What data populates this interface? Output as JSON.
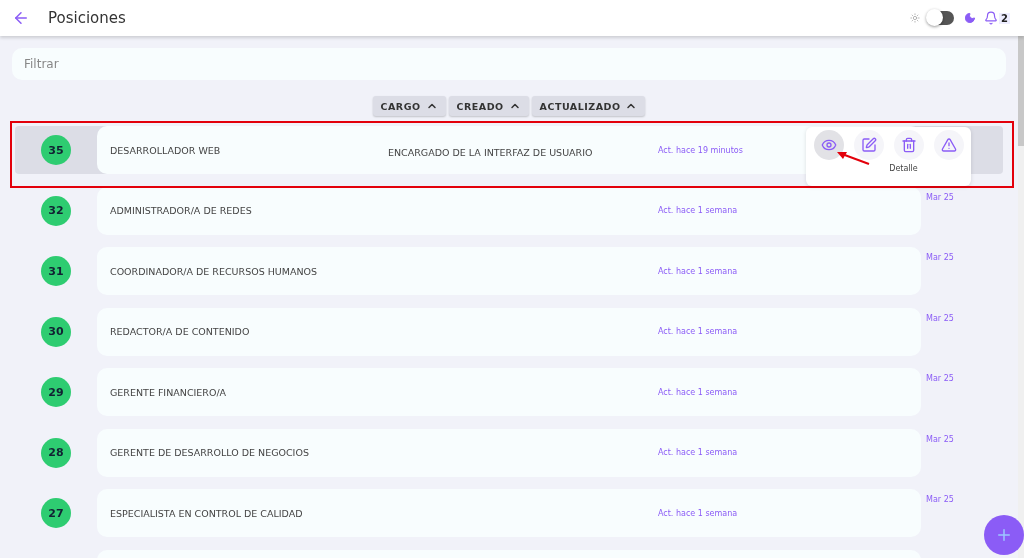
{
  "header": {
    "title": "Posiciones",
    "dark_mode": false,
    "notifications": "2"
  },
  "filter": {
    "placeholder": "Filtrar"
  },
  "sort_buttons": [
    {
      "label": "CARGO"
    },
    {
      "label": "CREADO"
    },
    {
      "label": "ACTUALIZADO"
    }
  ],
  "rows": [
    {
      "number": "35",
      "name": "DESARROLLADOR WEB",
      "description": "ENCARGADO DE LA INTERFAZ DE USUARIO",
      "updated": "Act. hace 19 minutos",
      "selected": true
    },
    {
      "number": "32",
      "name": "ADMINISTRADOR/A DE REDES",
      "updated": "Act. hace 1 semana",
      "date": "Mar 25",
      "selected": false
    },
    {
      "number": "31",
      "name": "COORDINADOR/A DE RECURSOS HUMANOS",
      "updated": "Act. hace 1 semana",
      "date": "Mar 25",
      "selected": false
    },
    {
      "number": "30",
      "name": "REDACTOR/A DE CONTENIDO",
      "updated": "Act. hace 1 semana",
      "date": "Mar 25",
      "selected": false
    },
    {
      "number": "29",
      "name": "GERENTE FINANCIERO/A",
      "updated": "Act. hace 1 semana",
      "date": "Mar 25",
      "selected": false
    },
    {
      "number": "28",
      "name": "GERENTE DE DESARROLLO DE NEGOCIOS",
      "updated": "Act. hace 1 semana",
      "date": "Mar 25",
      "selected": false
    },
    {
      "number": "27",
      "name": "ESPECIALISTA EN CONTROL DE CALIDAD",
      "updated": "Act. hace 1 semana",
      "date": "Mar 25",
      "selected": false
    }
  ],
  "action_menu": {
    "tooltip": "Detalle",
    "actions": [
      {
        "kind": "view",
        "selected": true
      },
      {
        "kind": "edit",
        "selected": false
      },
      {
        "kind": "delete",
        "selected": false
      },
      {
        "kind": "report",
        "selected": false
      }
    ]
  }
}
